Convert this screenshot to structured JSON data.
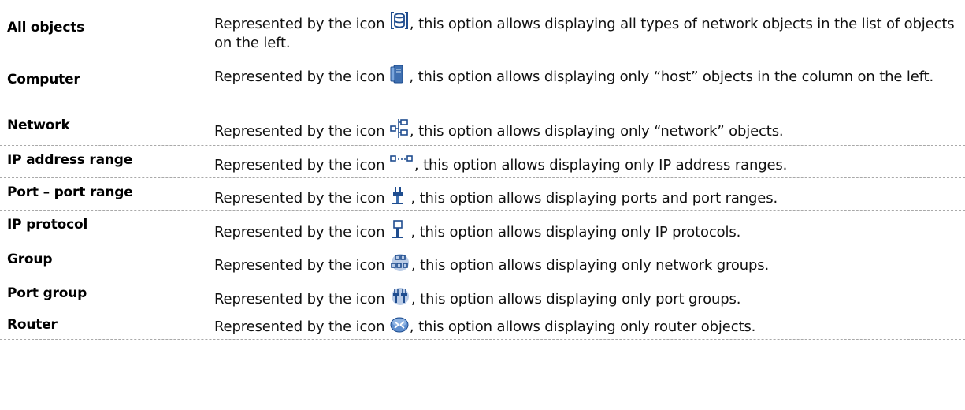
{
  "rows": [
    {
      "term": "All objects",
      "desc_before": "Represented by the icon ",
      "desc_after": ", this option allows displaying all types of network objects in the list of objects on the left.",
      "icon": "database-icon"
    },
    {
      "term": "Computer",
      "desc_before": "Represented by the icon ",
      "desc_after": " , this option allows displaying only “host” objects in the column on the left.",
      "icon": "computer-icon"
    },
    {
      "term": "Network",
      "desc_before": "Represented by the icon ",
      "desc_after": ", this option allows displaying only “network” objects.",
      "icon": "network-icon"
    },
    {
      "term": "IP address range",
      "desc_before": "Represented by the icon ",
      "desc_after": ", this option allows displaying only IP address ranges.",
      "icon": "ip-range-icon"
    },
    {
      "term": "Port – port range",
      "desc_before": "Represented by the icon ",
      "desc_after": " , this option allows displaying ports and port ranges.",
      "icon": "port-icon"
    },
    {
      "term": "IP protocol",
      "desc_before": "Represented by the icon ",
      "desc_after": " , this option allows displaying only IP protocols.",
      "icon": "ip-protocol-icon"
    },
    {
      "term": "Group",
      "desc_before": "Represented by the icon ",
      "desc_after": ", this option allows displaying only network groups.",
      "icon": "group-icon"
    },
    {
      "term": "Port group",
      "desc_before": "Represented by the icon ",
      "desc_after": ", this option allows displaying only port groups.",
      "icon": "port-group-icon"
    },
    {
      "term": "Router",
      "desc_before": "Represented by the icon ",
      "desc_after": ", this option allows displaying only router objects.",
      "icon": "router-icon"
    }
  ]
}
